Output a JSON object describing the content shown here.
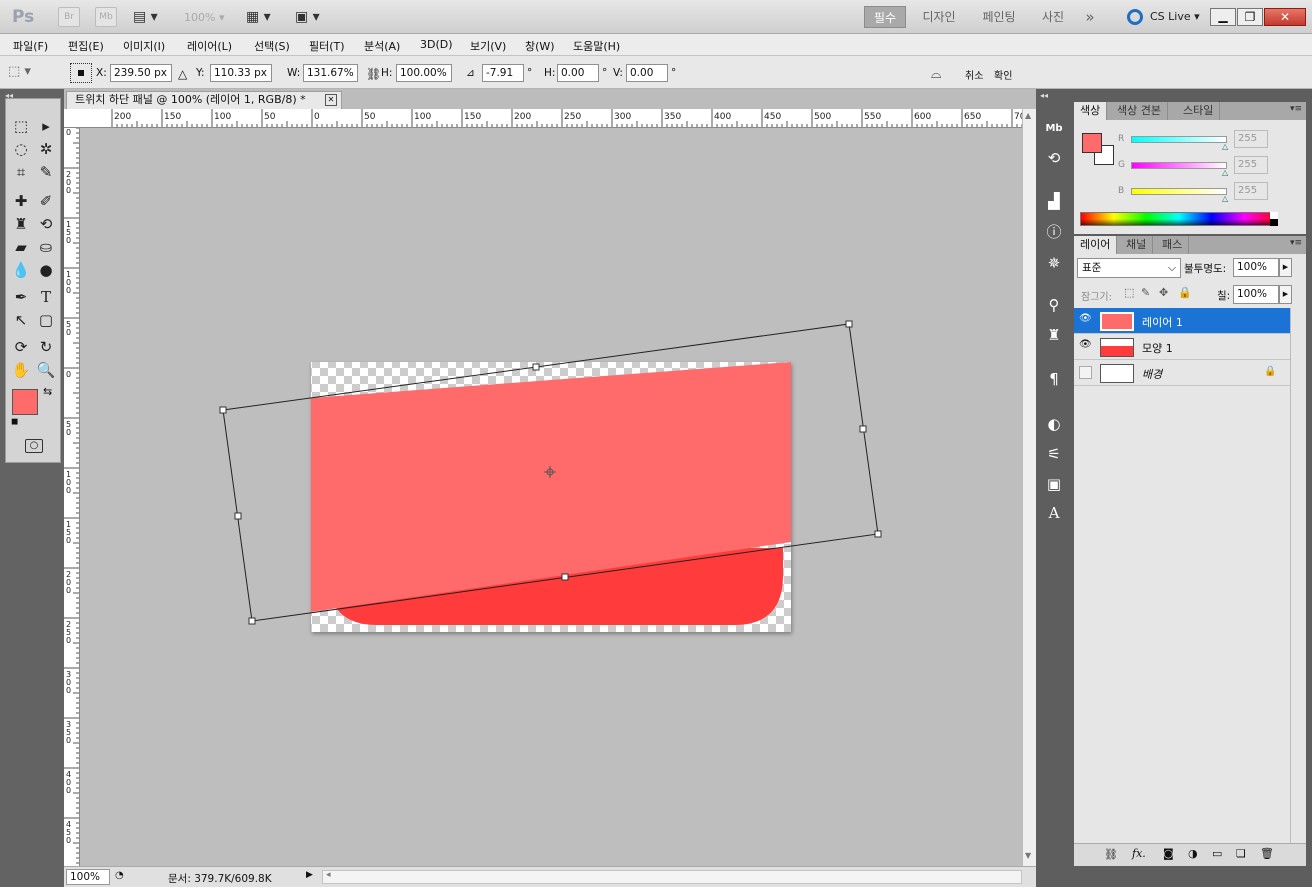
{
  "app": {
    "logo": "Ps",
    "bridge": "Br",
    "minibridge": "Mb",
    "zoom_display": "100%",
    "workspaces": [
      "필수",
      "디자인",
      "페인팅",
      "사진"
    ],
    "active_workspace": "필수",
    "more": "»",
    "cs_live": "CS Live"
  },
  "menu": [
    "파일(F)",
    "편집(E)",
    "이미지(I)",
    "레이어(L)",
    "선택(S)",
    "필터(T)",
    "분석(A)",
    "3D(D)",
    "보기(V)",
    "창(W)",
    "도움말(H)"
  ],
  "options": {
    "x_label": "X:",
    "x_value": "239.50 px",
    "y_label": "Y:",
    "y_value": "110.33 px",
    "w_label": "W:",
    "w_value": "131.67%",
    "h_label": "H:",
    "h_value": "100.00%",
    "angle_value": "-7.91",
    "deg": "°",
    "hskew_label": "H:",
    "hskew_value": "0.00",
    "vskew_label": "V:",
    "vskew_value": "0.00",
    "cancel": "취소",
    "commit": "확인"
  },
  "document": {
    "tab_title": "트위치 하단 패널 @ 100% (레이어 1, RGB/8) *",
    "close": "✕",
    "ruler_top_labels": [
      "200",
      "150",
      "100",
      "50",
      "0",
      "50",
      "100",
      "150",
      "200",
      "250",
      "300",
      "350",
      "400",
      "450",
      "500",
      "550",
      "600",
      "650",
      "70"
    ],
    "ruler_left_labels": [
      "5\n0",
      "2\n0\n0",
      "1\n5\n0",
      "1\n0\n0",
      "5\n0",
      "0",
      "5\n0",
      "1\n0\n0",
      "1\n5\n0",
      "2\n0\n0",
      "2\n5\n0",
      "3\n0\n0",
      "3\n5\n0",
      "4\n0\n0",
      "4\n5\n0"
    ],
    "colors": {
      "layer_fill": "#ff6b6b",
      "shape_fill": "#ff3b3b"
    }
  },
  "status": {
    "zoom": "100%",
    "doc_size": "문서: 379.7K/609.8K"
  },
  "color_panel": {
    "tabs": [
      "색상",
      "색상 견본",
      "스타일"
    ],
    "foreground": "#ff6b6b",
    "background": "#ffffff",
    "channels": [
      {
        "label": "R",
        "value": "255"
      },
      {
        "label": "G",
        "value": "255"
      },
      {
        "label": "B",
        "value": "255"
      }
    ]
  },
  "layers_panel": {
    "tabs": [
      "레이어",
      "채널",
      "패스"
    ],
    "blend_mode": "표준",
    "opacity_label": "불투명도:",
    "opacity_value": "100%",
    "lock_label": "잠그기:",
    "fill_label": "칠:",
    "fill_value": "100%",
    "layers": [
      {
        "name": "레이어 1",
        "selected": true,
        "visible": true
      },
      {
        "name": "모양 1",
        "selected": false,
        "visible": true
      },
      {
        "name": "배경",
        "selected": false,
        "visible": false,
        "locked": true
      }
    ]
  },
  "icons": {
    "eye": "eye-icon",
    "lock": "lock-icon"
  }
}
